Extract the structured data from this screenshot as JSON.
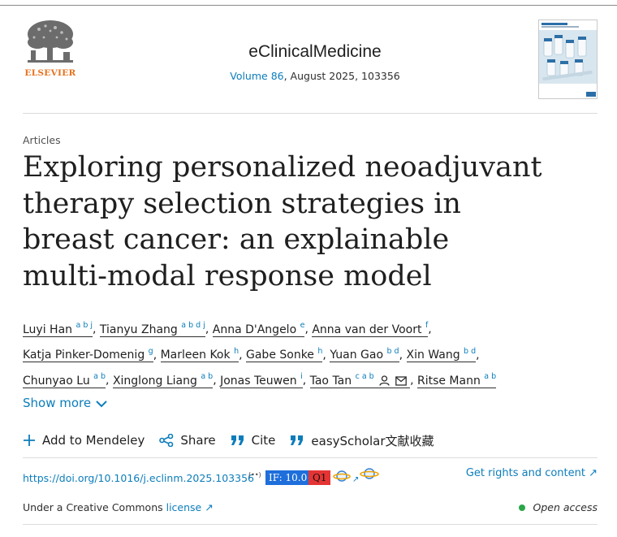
{
  "header": {
    "publisher": "ELSEVIER",
    "journal": "eClinicalMedicine",
    "volume_link": "Volume 86",
    "issue_rest": ", August 2025, 103356"
  },
  "article": {
    "type": "Articles",
    "title": "Exploring personalized neoadjuvant therapy selection strategies in breast cancer: an explainable multi-modal response model"
  },
  "authors": [
    {
      "name": "Luyi Han",
      "sup": "a b j"
    },
    {
      "name": "Tianyu Zhang",
      "sup": "a b d j"
    },
    {
      "name": "Anna D'Angelo",
      "sup": "e"
    },
    {
      "name": "Anna van der Voort",
      "sup": "f"
    },
    {
      "name": "Katja Pinker-Domenig",
      "sup": "g"
    },
    {
      "name": "Marleen Kok",
      "sup": "h"
    },
    {
      "name": "Gabe Sonke",
      "sup": "h"
    },
    {
      "name": "Yuan Gao",
      "sup": "b d"
    },
    {
      "name": "Xin Wang",
      "sup": "b d"
    },
    {
      "name": "Chunyao Lu",
      "sup": "a b"
    },
    {
      "name": "Xinglong Liang",
      "sup": "a b"
    },
    {
      "name": "Jonas Teuwen",
      "sup": "i"
    },
    {
      "name": "Tao Tan",
      "sup": "c a b"
    },
    {
      "name": "Ritse Mann",
      "sup": "a b"
    }
  ],
  "show_more": "Show more",
  "actions": {
    "mendeley": "Add to Mendeley",
    "share": "Share",
    "cite": "Cite",
    "easyscholar": "easyScholar文献收藏"
  },
  "doi": {
    "url": "https://doi.org/10.1016/j.eclinm.2025.103356",
    "ext_mark": "(••)",
    "impact_factor": "IF: 10.0",
    "quartile": "Q1",
    "arrow": "↗"
  },
  "rights": "Get rights and content ↗",
  "license": {
    "prefix": "Under a Creative Commons ",
    "link": "license ↗"
  },
  "open_access": "Open access",
  "colors": {
    "link": "#0c7dbb",
    "elsevier_orange": "#e9711c",
    "if_badge": "#1e6edb",
    "q1_badge": "#e53434",
    "open_access_dot": "#29a649"
  },
  "icons": [
    "elsevier-tree-logo",
    "journal-cover-thumbnail",
    "plus-icon",
    "share-icon",
    "quote-icon",
    "quote-icon",
    "chevron-down-icon",
    "person-icon",
    "mail-icon",
    "planet-icon",
    "external-arrow-icon"
  ]
}
